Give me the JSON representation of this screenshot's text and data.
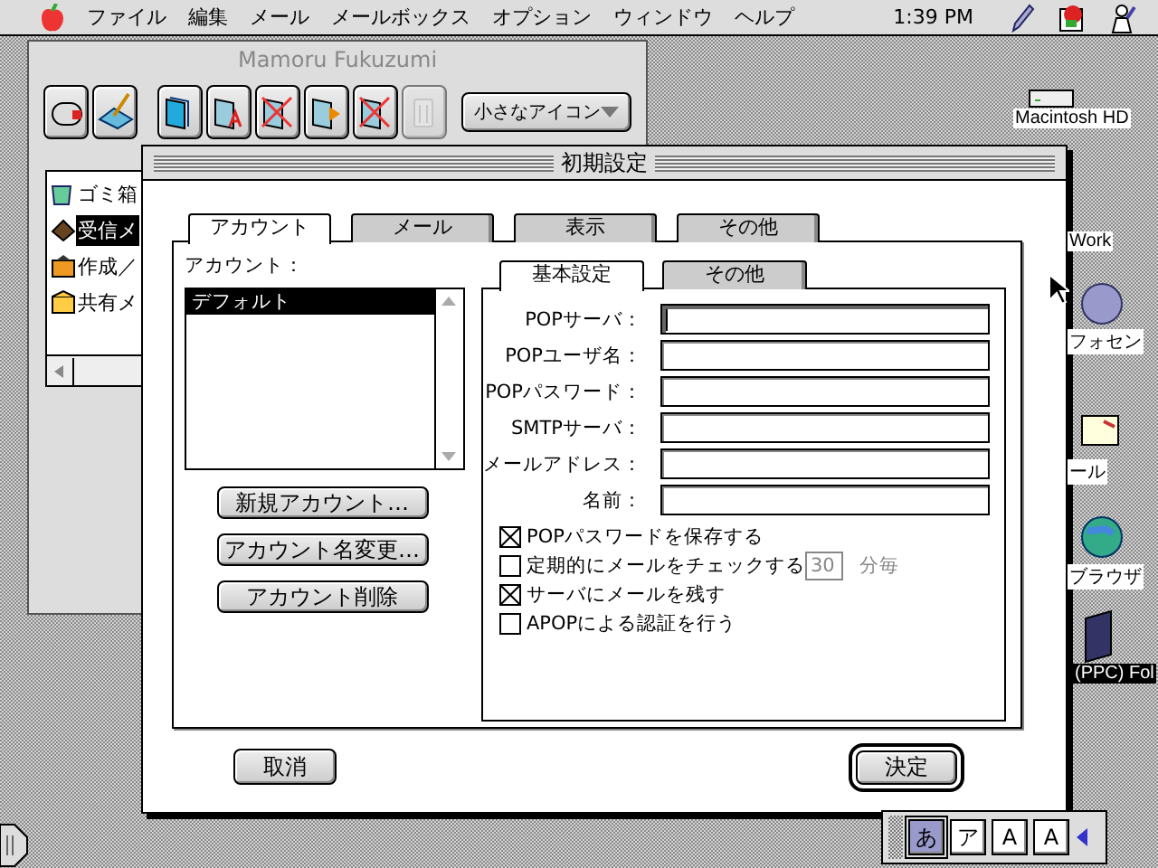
{
  "menu_bar": {
    "menus": [
      "ファイル",
      "編集",
      "メール",
      "メールボックス",
      "オプション",
      "ウィンドウ",
      "ヘルプ"
    ],
    "clock": "1:39 PM"
  },
  "mailbox_window": {
    "title": "Mamoru Fukuzumi",
    "view_menu": "小さなアイコン",
    "toolbar": [
      {
        "kind": "mailbox",
        "disabled": false
      },
      {
        "kind": "compose",
        "disabled": false
      },
      {
        "kind": "folder",
        "disabled": false
      },
      {
        "kind": "folder-a",
        "disabled": false
      },
      {
        "kind": "folder-x",
        "disabled": false
      },
      {
        "kind": "folder-arrow",
        "disabled": false
      },
      {
        "kind": "folder-x",
        "disabled": false
      },
      {
        "kind": "trash",
        "disabled": true
      }
    ],
    "items": [
      {
        "kind": "trash",
        "label": "ゴミ箱",
        "selected": false
      },
      {
        "kind": "inbox",
        "label": "受信メ",
        "selected": true
      },
      {
        "kind": "outbox",
        "label": "作成／",
        "selected": false
      },
      {
        "kind": "shared",
        "label": "共有メ",
        "selected": false
      }
    ]
  },
  "desktop_icons": [
    {
      "kind": "disk",
      "label": "Macintosh HD",
      "selected": false
    },
    {
      "kind": "plain",
      "label": "Work",
      "selected": false
    },
    {
      "kind": "sphere",
      "label": "フォセン",
      "selected": false
    },
    {
      "kind": "letter",
      "label": "ール",
      "selected": false
    },
    {
      "kind": "globe",
      "label": "ブラウザ",
      "selected": false
    },
    {
      "kind": "folder",
      "label": "(PPC) Fol",
      "selected": true
    }
  ],
  "dialog": {
    "title": "初期設定",
    "tabs": [
      {
        "label": "アカウント",
        "selected": true
      },
      {
        "label": "メール",
        "selected": false
      },
      {
        "label": "表示",
        "selected": false
      },
      {
        "label": "その他",
        "selected": false
      }
    ],
    "accounts_label": "アカウント：",
    "accounts": [
      {
        "label": "デフォルト",
        "selected": true
      }
    ],
    "account_buttons": [
      "新規アカウント…",
      "アカウント名変更…",
      "アカウント削除"
    ],
    "subtabs": [
      {
        "label": "基本設定",
        "selected": true
      },
      {
        "label": "その他",
        "selected": false
      }
    ],
    "fields": [
      {
        "label": "POPサーバ：",
        "focused": true
      },
      {
        "label": "POPユーザ名：",
        "focused": false
      },
      {
        "label": "POPパスワード：",
        "focused": false
      },
      {
        "label": "SMTPサーバ：",
        "focused": false
      },
      {
        "label": "メールアドレス：",
        "focused": false
      },
      {
        "label": "名前：",
        "focused": false
      }
    ],
    "checkboxes": [
      {
        "label": "POPパスワードを保存する",
        "checked": true
      },
      {
        "label": "定期的にメールをチェックする",
        "checked": false
      },
      {
        "label": "サーバにメールを残す",
        "checked": true
      },
      {
        "label": "APOPによる認証を行う",
        "checked": false
      }
    ],
    "interval": {
      "value": "30",
      "unit": "分毎",
      "disabled": true
    },
    "buttons": [
      {
        "label": "取消",
        "default": false
      },
      {
        "label": "決定",
        "default": true
      }
    ]
  },
  "ime_palette": {
    "modes": [
      {
        "label": "あ",
        "selected": true
      },
      {
        "label": "ア",
        "selected": false
      },
      {
        "label": "A",
        "selected": false
      },
      {
        "label": "A",
        "selected": false
      }
    ]
  }
}
